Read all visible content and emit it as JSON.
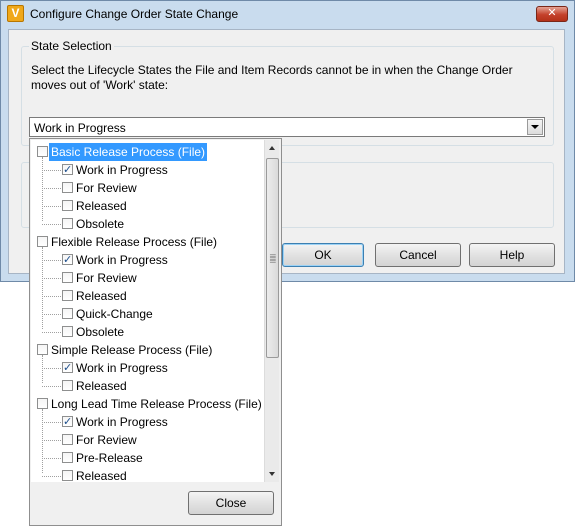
{
  "window": {
    "title": "Configure Change Order State Change",
    "app_icon": "vault-app-icon",
    "close_symbol": "✕"
  },
  "state_selection": {
    "group_title": "State Selection",
    "instruction": "Select the Lifecycle States the File and Item Records cannot be in when the Change Order moves out of 'Work' state:",
    "combo_value": "Work in Progress"
  },
  "buttons": {
    "ok": "OK",
    "cancel": "Cancel",
    "help": "Help"
  },
  "popup": {
    "close": "Close",
    "tree": [
      {
        "label": "Basic Release Process (File)",
        "checked": false,
        "selected": true,
        "children": [
          {
            "label": "Work in Progress",
            "checked": true
          },
          {
            "label": "For Review",
            "checked": false
          },
          {
            "label": "Released",
            "checked": false
          },
          {
            "label": "Obsolete",
            "checked": false
          }
        ]
      },
      {
        "label": "Flexible Release Process (File)",
        "checked": false,
        "selected": false,
        "children": [
          {
            "label": "Work in Progress",
            "checked": true
          },
          {
            "label": "For Review",
            "checked": false
          },
          {
            "label": "Released",
            "checked": false
          },
          {
            "label": "Quick-Change",
            "checked": false
          },
          {
            "label": "Obsolete",
            "checked": false
          }
        ]
      },
      {
        "label": "Simple Release Process (File)",
        "checked": false,
        "selected": false,
        "children": [
          {
            "label": "Work in Progress",
            "checked": true
          },
          {
            "label": "Released",
            "checked": false
          }
        ]
      },
      {
        "label": "Long Lead Time Release Process (File)",
        "checked": false,
        "selected": false,
        "children": [
          {
            "label": "Work in Progress",
            "checked": true
          },
          {
            "label": "For Review",
            "checked": false
          },
          {
            "label": "Pre-Release",
            "checked": false
          },
          {
            "label": "Released",
            "checked": false
          }
        ]
      }
    ]
  }
}
